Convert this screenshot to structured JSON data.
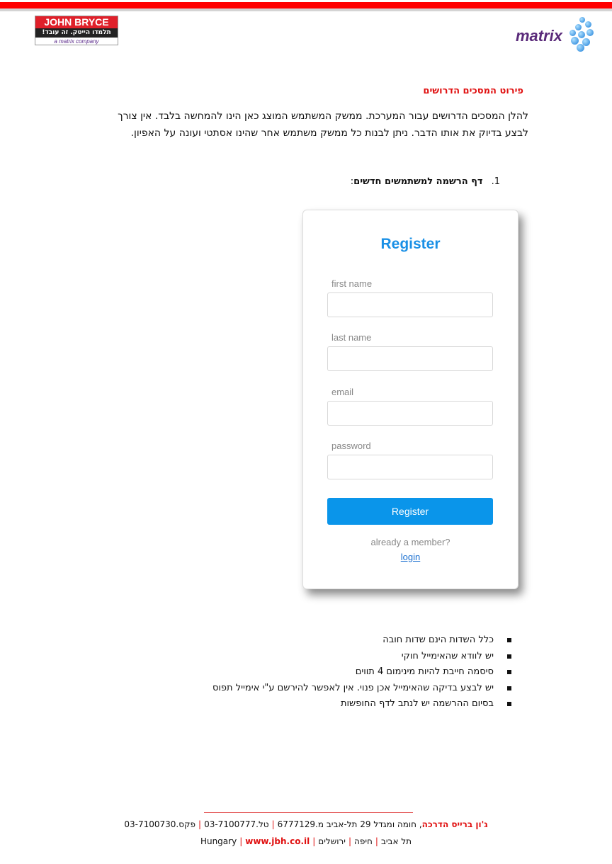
{
  "header": {
    "left_logo": {
      "line1": "JOHN BRYCE",
      "line2": "תלמדו הייטק. זה עובד!",
      "line3": "a matrix company"
    },
    "right_logo": "matrix",
    "accent": "#ff0000"
  },
  "doc": {
    "heading": "פירוט המסכים הדרושים",
    "paragraph": "להלן המסכים הדרושים עבור המערכת. ממשק המשתמש המוצג כאן הינו להמחשה בלבד. אין צורך לבצע בדיוק את אותו הדבר. ניתן לבנות כל ממשק משתמש אחר שהינו אסתטי ועונה על האפיון.",
    "item_number": "1.",
    "item_title": "דף הרשמה למשתמשים חדשים",
    "bullets": [
      "כלל השדות הינם שדות חובה",
      "יש לוודא שהאימייל חוקי",
      "סיסמה חייבת להיות מינימום 4 תווים",
      "יש לבצע בדיקה שהאימייל אכן פנוי. אין לאפשר להירשם ע\"י אימייל תפוס",
      "בסיום ההרשמה יש לנתב לדף החופשות"
    ]
  },
  "register": {
    "title": "Register",
    "fields": [
      {
        "label": "first name",
        "value": ""
      },
      {
        "label": "last name",
        "value": ""
      },
      {
        "label": "email",
        "value": ""
      },
      {
        "label": "password",
        "value": ""
      }
    ],
    "button": "Register",
    "member_text": "already a member?",
    "login_link": "login",
    "accent": "#0a95ea"
  },
  "footer": {
    "company": "ג'ון ברייס הדרכה",
    "address": ", חומה ומגדל 29 תל-אביב  מ.6777129",
    "phone": "טל.03-7100777",
    "fax": "פקס.03-7100730",
    "cities": [
      "תל אביב",
      "חיפה",
      "ירושלים",
      "Hungary"
    ],
    "website": "www.jbh.co.il"
  }
}
